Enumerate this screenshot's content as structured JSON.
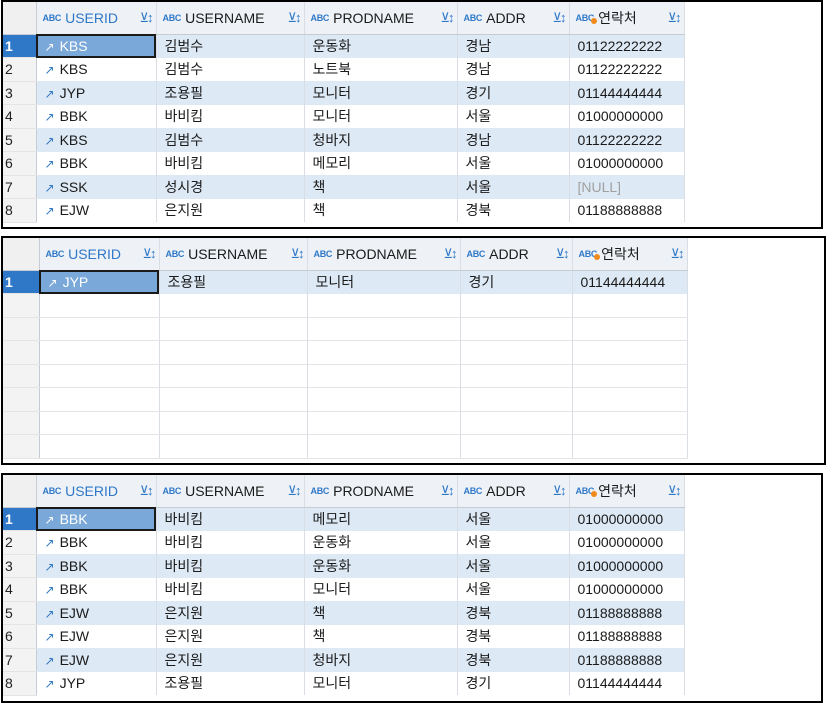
{
  "columns": [
    {
      "type": "ABC",
      "label": "USERID"
    },
    {
      "type": "ABC",
      "label": "USERNAME"
    },
    {
      "type": "ABC",
      "label": "PRODNAME"
    },
    {
      "type": "ABC",
      "label": "ADDR"
    },
    {
      "type": "ABC",
      "label": "연락처"
    }
  ],
  "icons": {
    "filter": "filter-sort-icon",
    "link": "link-icon"
  },
  "colors": {
    "accent": "#2f78c8",
    "selected_row": "#2f78c8",
    "alt_row": "#dde9f5",
    "active_cell": "#7aa8d8"
  },
  "grids": [
    {
      "rows": [
        {
          "num": "1",
          "userid": "KBS",
          "username": "김범수",
          "prodname": "운동화",
          "addr": "경남",
          "phone": "01122222222"
        },
        {
          "num": "2",
          "userid": "KBS",
          "username": "김범수",
          "prodname": "노트북",
          "addr": "경남",
          "phone": "01122222222"
        },
        {
          "num": "3",
          "userid": "JYP",
          "username": "조용필",
          "prodname": "모니터",
          "addr": "경기",
          "phone": "01144444444"
        },
        {
          "num": "4",
          "userid": "BBK",
          "username": "바비킴",
          "prodname": "모니터",
          "addr": "서울",
          "phone": "01000000000"
        },
        {
          "num": "5",
          "userid": "KBS",
          "username": "김범수",
          "prodname": "청바지",
          "addr": "경남",
          "phone": "01122222222"
        },
        {
          "num": "6",
          "userid": "BBK",
          "username": "바비킴",
          "prodname": "메모리",
          "addr": "서울",
          "phone": "01000000000"
        },
        {
          "num": "7",
          "userid": "SSK",
          "username": "성시경",
          "prodname": "책",
          "addr": "서울",
          "phone": "[NULL]"
        },
        {
          "num": "8",
          "userid": "EJW",
          "username": "은지원",
          "prodname": "책",
          "addr": "경북",
          "phone": "01188888888"
        }
      ]
    },
    {
      "rows": [
        {
          "num": "1",
          "userid": "JYP",
          "username": "조용필",
          "prodname": "모니터",
          "addr": "경기",
          "phone": "01144444444"
        }
      ]
    },
    {
      "rows": [
        {
          "num": "1",
          "userid": "BBK",
          "username": "바비킴",
          "prodname": "메모리",
          "addr": "서울",
          "phone": "01000000000"
        },
        {
          "num": "2",
          "userid": "BBK",
          "username": "바비킴",
          "prodname": "운동화",
          "addr": "서울",
          "phone": "01000000000"
        },
        {
          "num": "3",
          "userid": "BBK",
          "username": "바비킴",
          "prodname": "운동화",
          "addr": "서울",
          "phone": "01000000000"
        },
        {
          "num": "4",
          "userid": "BBK",
          "username": "바비킴",
          "prodname": "모니터",
          "addr": "서울",
          "phone": "01000000000"
        },
        {
          "num": "5",
          "userid": "EJW",
          "username": "은지원",
          "prodname": "책",
          "addr": "경북",
          "phone": "01188888888"
        },
        {
          "num": "6",
          "userid": "EJW",
          "username": "은지원",
          "prodname": "책",
          "addr": "경북",
          "phone": "01188888888"
        },
        {
          "num": "7",
          "userid": "EJW",
          "username": "은지원",
          "prodname": "청바지",
          "addr": "경북",
          "phone": "01188888888"
        },
        {
          "num": "8",
          "userid": "JYP",
          "username": "조용필",
          "prodname": "모니터",
          "addr": "경기",
          "phone": "01144444444"
        }
      ]
    }
  ]
}
